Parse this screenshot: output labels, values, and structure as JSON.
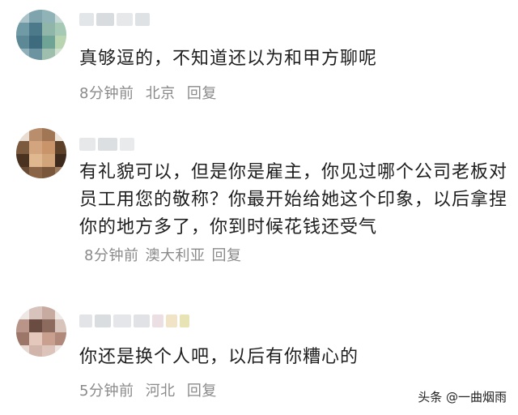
{
  "comments": [
    {
      "text": "真够逗的，不知道还以为和甲方聊呢",
      "time": "8分钟前",
      "location": "北京",
      "reply_label": "回复"
    },
    {
      "text": "有礼貌可以，但是你是雇主，你见过哪个公司老板对员工用您的敬称？你最开始给她这个印象，以后拿捏你的地方多了，你到时候花钱还受气",
      "time": "8分钟前",
      "location": "澳大利亚",
      "reply_label": "回复"
    },
    {
      "text": "你还是换个人吧，以后有你糟心的",
      "time": "5分钟前",
      "location": "河北",
      "reply_label": "回复"
    }
  ],
  "watermark": "头条 @一曲烟雨"
}
